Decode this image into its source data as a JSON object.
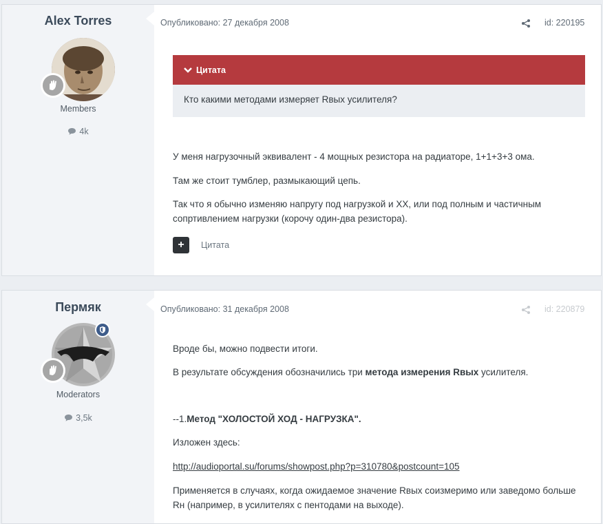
{
  "posts": [
    {
      "author": "Alex Torres",
      "group": "Members",
      "post_count": "4k",
      "published": "Опубликовано: 27 декабря 2008",
      "id": "id: 220195",
      "quote": {
        "label": "Цитата",
        "text": "Кто какими методами измеряет Rвых усилителя?"
      },
      "paragraphs": [
        "У меня нагрузочный эквивалент - 4 мощных резистора на радиаторе, 1+1+3+3 ома.",
        "Там же стоит тумблер, размыкающий цепь.",
        "Так что я обычно изменяю напругу под нагрузкой и ХХ, или под полным и частичным сопртивлением нагрузки (корочу один-два резистора)."
      ],
      "quote_button": "Цитата"
    },
    {
      "author": "Пермяк",
      "group": "Moderators",
      "post_count": "3,5k",
      "published": "Опубликовано: 31 декабря 2008",
      "id": "id: 220879",
      "p1": "Вроде бы, можно подвести итоги.",
      "p2_pre": "В результате обсуждения обозначились три ",
      "p2_bold": "метода измерения Rвых",
      "p2_post": " усилителя.",
      "p3_pre": "--1.",
      "p3_bold": "Метод \"ХОЛОСТОЙ ХОД - НАГРУЗКА\".",
      "p4": "Изложен здесь:",
      "link": "http://audioportal.su/forums/showpost.php?p=310780&postcount=105",
      "p5": "Применяется в случаях, когда ожидаемое значение Rвых соизмеримо или заведомо больше Rн (например, в усилителях с пентодами на выходе)."
    }
  ],
  "colors": {
    "quote_header": "#b53a3e",
    "author_panel": "#f2f4f7",
    "badge": "#3e5c8a"
  }
}
